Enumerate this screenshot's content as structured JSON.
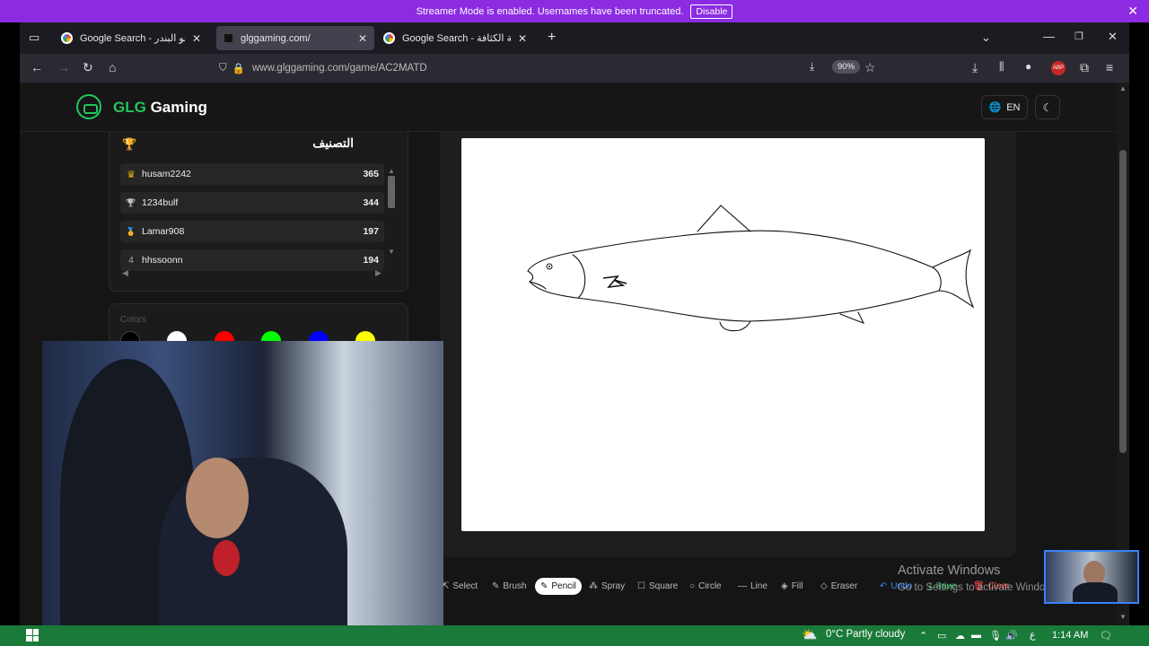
{
  "streamer": {
    "message": "Streamer Mode is enabled. Usernames have been truncated.",
    "disable_label": "Disable"
  },
  "tabs": [
    {
      "title": "Google Search - ما هو البندر"
    },
    {
      "title": "glggaming.com/"
    },
    {
      "title": "Google Search - صيغة الكثافة"
    }
  ],
  "url": "www.glggaming.com/game/AC2MATD",
  "zoom": "90%",
  "site": {
    "brand_green": "GLG",
    "brand_white": " Gaming",
    "lang": "EN"
  },
  "leaderboard": {
    "title": "التصنيف",
    "players": [
      {
        "rank": "♛",
        "name": "husam2242",
        "score": "365"
      },
      {
        "rank": "🏆",
        "name": "1234bulf",
        "score": "344"
      },
      {
        "rank": "🏅",
        "name": "Lamar908",
        "score": "197"
      },
      {
        "rank": "4",
        "name": "hhssoonn",
        "score": "194"
      }
    ]
  },
  "colors": {
    "label": "Colors",
    "swatches": [
      "#000000",
      "#ffffff",
      "#ff0000",
      "#00ff00",
      "#0000ff",
      "#ffff00"
    ]
  },
  "tools": {
    "select": "Select",
    "brush": "Brush",
    "pencil": "Pencil",
    "spray": "Spray",
    "square": "Square",
    "circle": "Circle",
    "line": "Line",
    "fill": "Fill",
    "eraser": "Eraser",
    "undo": "Undo",
    "save": "Save",
    "clear": "Clear"
  },
  "watermark": {
    "line1": "Activate Windows",
    "line2": "Go to Settings to activate Windows."
  },
  "taskbar": {
    "weather": "0°C  Partly cloudy",
    "lang": "ع",
    "time": "1:14 AM"
  },
  "accent": "#22c55e"
}
